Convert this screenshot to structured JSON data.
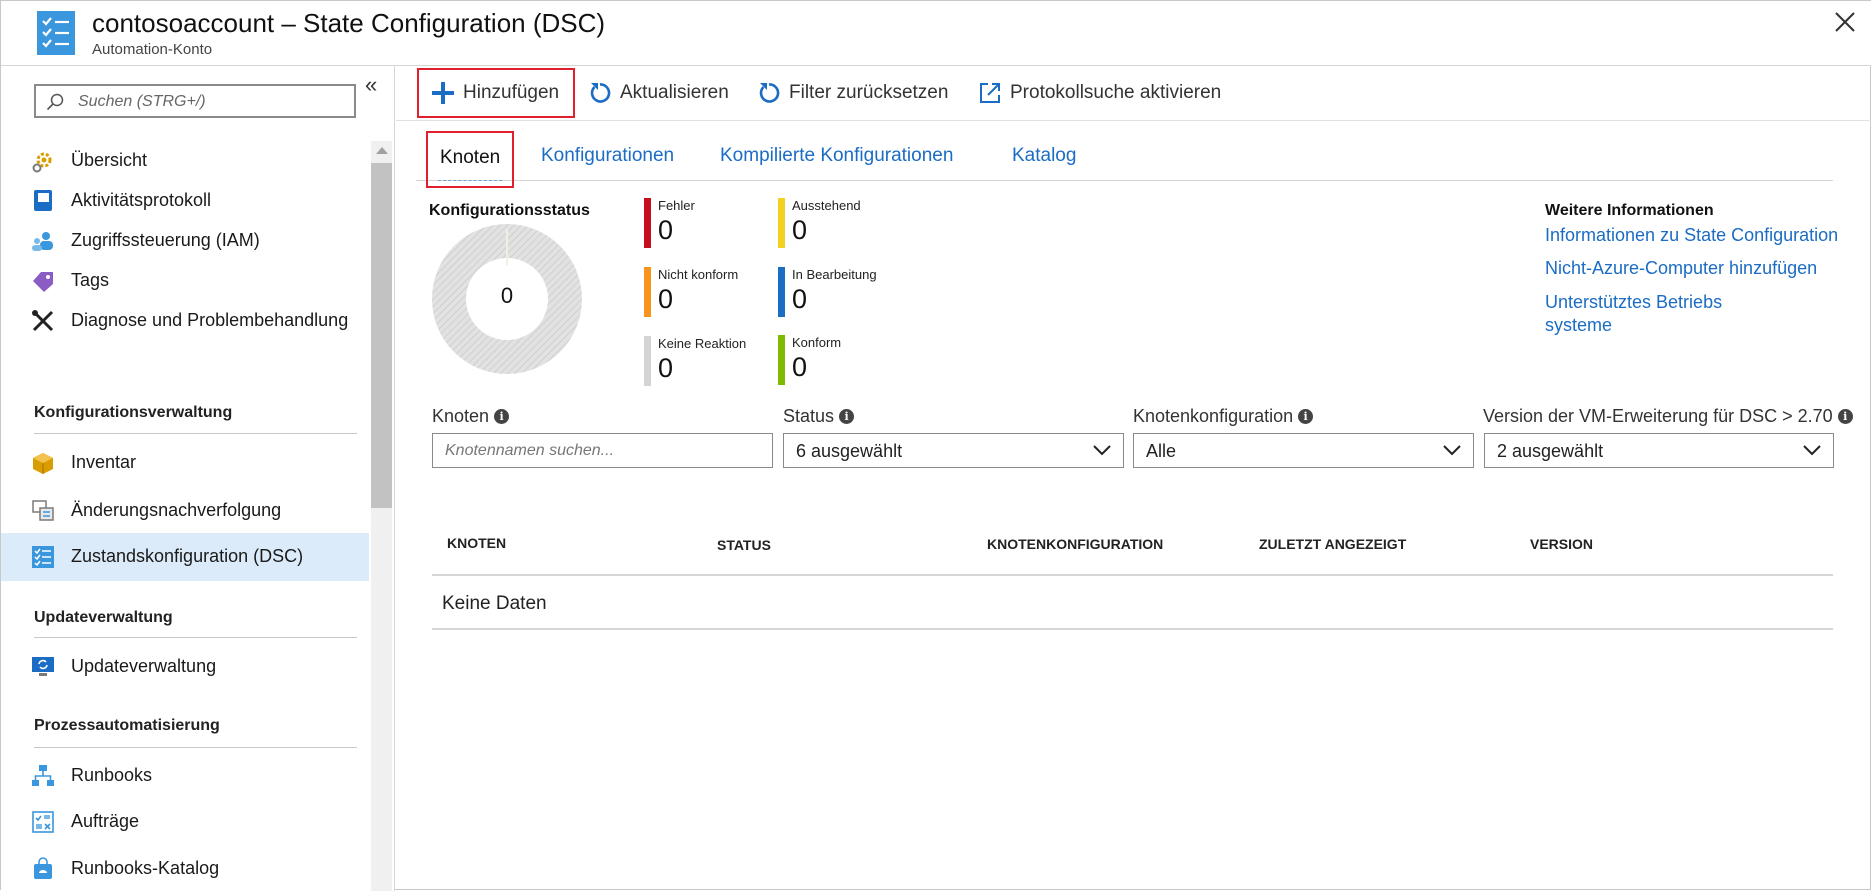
{
  "header": {
    "title": "contosoaccount – State Configuration (DSC)",
    "subtitle": "Automation-Konto"
  },
  "sidebar": {
    "search_placeholder": "Suchen (STRG+/)",
    "items_top": [
      {
        "label": "Übersicht",
        "icon": "gear-icon"
      },
      {
        "label": "Aktivitätsprotokoll",
        "icon": "log-book-icon"
      },
      {
        "label": "Zugriffssteuerung (IAM)",
        "icon": "users-icon"
      },
      {
        "label": "Tags",
        "icon": "tag-icon"
      },
      {
        "label": "Diagnose und Problembehandlung",
        "icon": "wrench-icon"
      }
    ],
    "sections": [
      {
        "title": "Konfigurationsverwaltung",
        "items": [
          {
            "label": "Inventar",
            "icon": "box-icon"
          },
          {
            "label": "Änderungsnachverfolgung",
            "icon": "change-tracking-icon"
          },
          {
            "label": "Zustandskonfiguration (DSC)",
            "icon": "checklist-icon",
            "selected": true
          }
        ]
      },
      {
        "title": "Updateverwaltung",
        "items": [
          {
            "label": "Updateverwaltung",
            "icon": "update-monitor-icon"
          }
        ]
      },
      {
        "title": "Prozessautomatisierung",
        "items": [
          {
            "label": "Runbooks",
            "icon": "hierarchy-icon"
          },
          {
            "label": "Aufträge",
            "icon": "jobs-icon"
          },
          {
            "label": "Runbooks-Katalog",
            "icon": "gallery-bag-icon"
          }
        ]
      }
    ]
  },
  "toolbar": {
    "add": "Hinzufügen",
    "refresh": "Aktualisieren",
    "reset_filter": "Filter zurücksetzen",
    "log_search": "Protokollsuche aktivieren"
  },
  "tabs": [
    "Knoten",
    "Konfigurationen",
    "Kompilierte Konfigurationen",
    "Katalog"
  ],
  "status": {
    "title": "Konfigurationsstatus",
    "total": "0",
    "legend": [
      {
        "name": "Fehler",
        "value": "0",
        "color": "#c50f1f"
      },
      {
        "name": "Ausstehend",
        "value": "0",
        "color": "#f2d21f"
      },
      {
        "name": "Nicht konform",
        "value": "0",
        "color": "#f7941d"
      },
      {
        "name": "In Bearbeitung",
        "value": "0",
        "color": "#1b6cc4"
      },
      {
        "name": "Keine Reaktion",
        "value": "0",
        "color": "#d4d4d4"
      },
      {
        "name": "Konform",
        "value": "0",
        "color": "#7fba00"
      }
    ]
  },
  "more_info": {
    "title": "Weitere Informationen",
    "links": [
      "Informationen zu State Configuration",
      "Nicht-Azure-Computer hinzufügen",
      "Unterstütztes Betriebs",
      "systeme"
    ]
  },
  "filters": {
    "nodes_label": "Knoten",
    "nodes_placeholder": "Knotennamen suchen...",
    "status_label": "Status",
    "status_value": "6 ausgewählt",
    "nodeconfig_label": "Knotenkonfiguration",
    "nodeconfig_value": "Alle",
    "version_label": "Version der VM-Erweiterung für DSC > 2.70",
    "version_value": "2 ausgewählt"
  },
  "table": {
    "columns": [
      "KNOTEN",
      "STATUS",
      "KNOTENKONFIGURATION",
      "ZULETZT ANGEZEIGT",
      "VERSION"
    ],
    "empty_text": "Keine Daten"
  }
}
